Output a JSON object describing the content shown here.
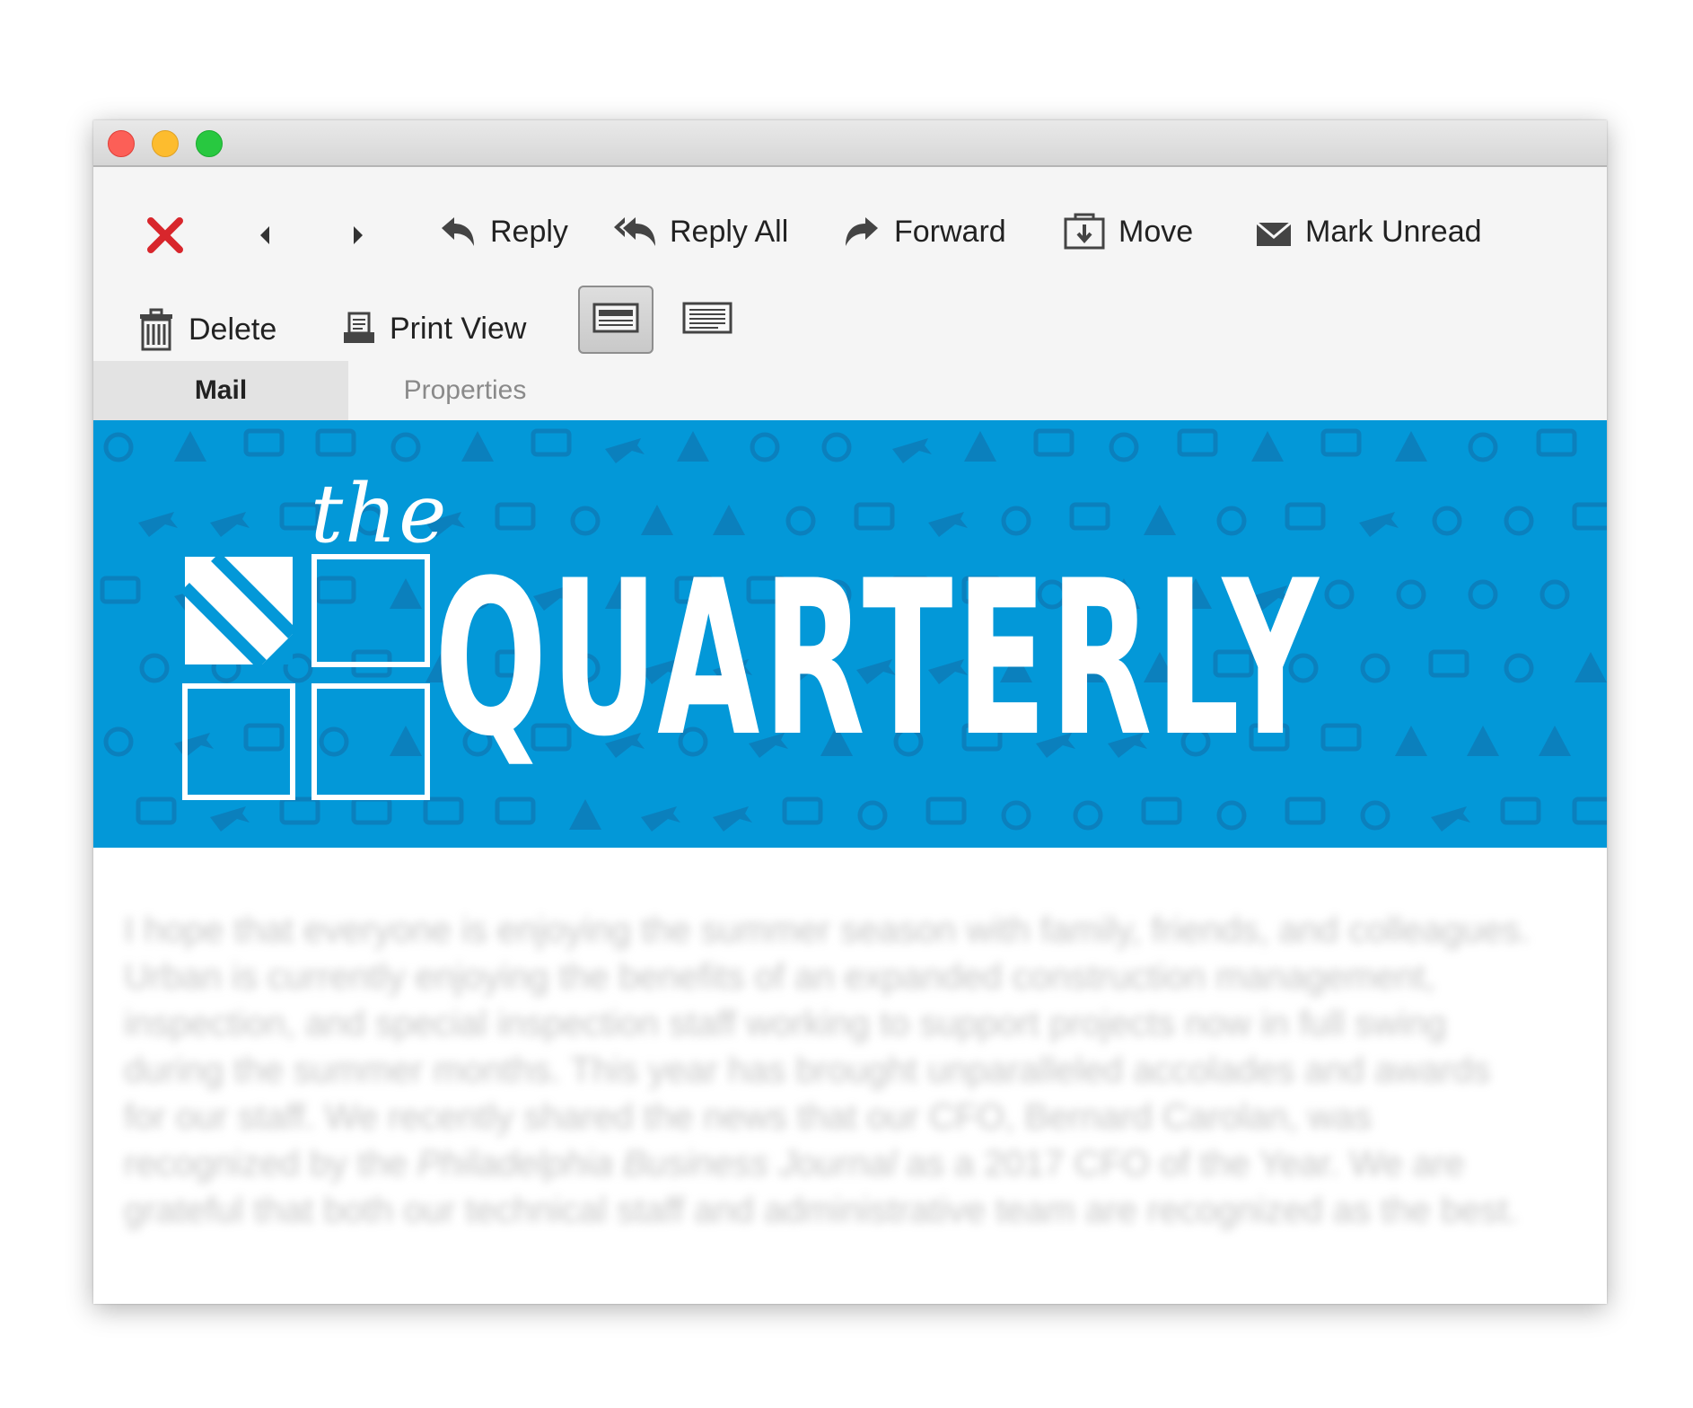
{
  "window": {
    "controls": [
      "close",
      "minimize",
      "maximize"
    ]
  },
  "toolbar": {
    "row1": [
      {
        "name": "delete-x-button",
        "icon": "close-x-icon",
        "label": ""
      },
      {
        "name": "previous-button",
        "icon": "caret-left-icon",
        "label": ""
      },
      {
        "name": "next-button",
        "icon": "caret-right-icon",
        "label": ""
      },
      {
        "name": "reply-button",
        "icon": "reply-arrow-icon",
        "label": "Reply"
      },
      {
        "name": "reply-all-button",
        "icon": "reply-all-arrow-icon",
        "label": "Reply All"
      },
      {
        "name": "forward-button",
        "icon": "forward-arrow-icon",
        "label": "Forward"
      },
      {
        "name": "move-button",
        "icon": "move-tray-icon",
        "label": "Move"
      },
      {
        "name": "mark-unread-button",
        "icon": "envelope-icon",
        "label": "Mark Unread"
      }
    ],
    "row2": [
      {
        "name": "delete-button",
        "icon": "trash-icon",
        "label": "Delete"
      },
      {
        "name": "print-view-button",
        "icon": "printer-icon",
        "label": "Print View"
      }
    ],
    "view_modes": [
      {
        "name": "view-header-layout-button",
        "icon": "header-view-icon",
        "active": true
      },
      {
        "name": "view-plain-layout-button",
        "icon": "plain-view-icon",
        "active": false
      }
    ]
  },
  "tabs": [
    {
      "label": "Mail",
      "active": true
    },
    {
      "label": "Properties",
      "active": false
    }
  ],
  "banner": {
    "small_word": "the",
    "title": "QUARTERLY",
    "background": "#0398d8"
  },
  "message": {
    "paragraph_before": "I hope that everyone is enjoying the summer season with family, friends, and colleagues. Urban is currently enjoying the benefits of an expanded construction management, inspection, and special inspection staff working to support projects now in full swing during the summer months. This year has brought unparalleled accolades and awards for our staff. We recently shared the news that our CFO, Bernard Carolan, was recognized by the ",
    "publication": "Philadelphia Business Journal",
    "paragraph_after": " as a 2017 CFO of the Year. We are grateful that both our technical staff and administrative team are recognized as the best."
  },
  "colors": {
    "accent": "#0398d8",
    "close_red": "#d8262c",
    "toolbar_bg": "#f5f5f5"
  }
}
